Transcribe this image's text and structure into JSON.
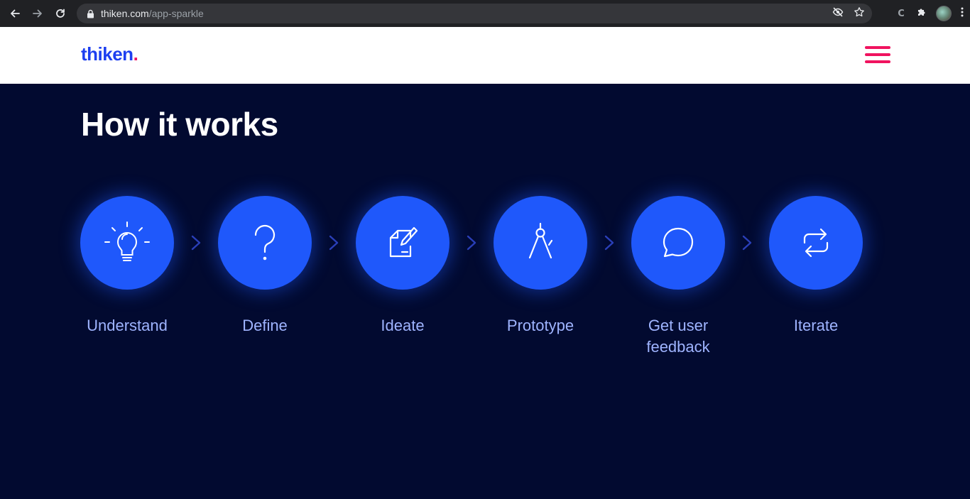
{
  "browser": {
    "url_domain": "thiken.com",
    "url_path": "/app-sparkle",
    "icons": [
      "back-icon",
      "forward-icon",
      "reload-icon",
      "lock-icon",
      "eye-off-icon",
      "star-icon",
      "extension-c-icon",
      "puzzle-icon",
      "avatar",
      "more-icon"
    ],
    "extension_badge": "C"
  },
  "site": {
    "logo_text": "thiken",
    "logo_dot": ".",
    "brand_color": "#1d3ff0",
    "accent_color": "#f0135f"
  },
  "section": {
    "title": "How it works",
    "background": "#020a30",
    "circle_color": "#1f58fb",
    "steps": [
      {
        "label": "Understand",
        "icon": "lightbulb-icon"
      },
      {
        "label": "Define",
        "icon": "question-mark-icon"
      },
      {
        "label": "Ideate",
        "icon": "note-pencil-icon"
      },
      {
        "label": "Prototype",
        "icon": "compass-icon"
      },
      {
        "label": "Get user feedback",
        "icon": "chat-bubble-icon"
      },
      {
        "label": "Iterate",
        "icon": "refresh-icon"
      }
    ]
  }
}
